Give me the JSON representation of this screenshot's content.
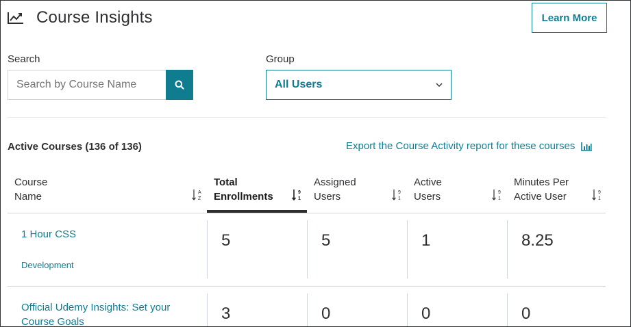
{
  "header": {
    "title": "Course Insights",
    "icon": "line-chart-icon",
    "learn_more": "Learn More"
  },
  "search": {
    "label": "Search",
    "placeholder": "Search by Course Name",
    "button_icon": "search-icon"
  },
  "group": {
    "label": "Group",
    "selected": "All Users"
  },
  "courses": {
    "summary": "Active Courses (136 of 136)",
    "export_label": "Export the Course Activity report for these courses",
    "export_icon": "bar-chart-icon",
    "columns": [
      {
        "line1": "Course",
        "line2": "Name",
        "sort_icon": "sort-alpha-asc-icon"
      },
      {
        "line1": "Total",
        "line2": "Enrollments",
        "sort_icon": "sort-numeric-desc-icon"
      },
      {
        "line1": "Assigned",
        "line2": "Users",
        "sort_icon": "sort-numeric-desc-icon"
      },
      {
        "line1": "Active",
        "line2": "Users",
        "sort_icon": "sort-numeric-desc-icon"
      },
      {
        "line1": "Minutes Per",
        "line2": "Active User",
        "sort_icon": "sort-numeric-desc-icon"
      }
    ],
    "rows": [
      {
        "name": "1 Hour CSS",
        "category": "Development",
        "total_enrollments": "5",
        "assigned_users": "5",
        "active_users": "1",
        "minutes_per_user": "8.25"
      },
      {
        "name_line1": "Official Udemy Insights: Set your",
        "name_line2": "Course Goals",
        "total_enrollments": "3",
        "assigned_users": "0",
        "active_users": "0",
        "minutes_per_user": "0"
      }
    ]
  },
  "colors": {
    "accent": "#0f7c90",
    "text": "#2d2f31",
    "border": "#d1d7dc"
  }
}
